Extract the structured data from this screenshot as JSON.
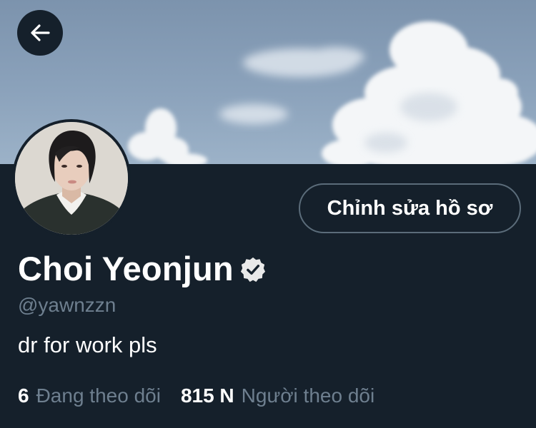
{
  "profile": {
    "display_name": "Choi Yeonjun",
    "handle": "@yawnzzn",
    "bio": "dr for work pls",
    "verified": true
  },
  "actions": {
    "back_icon": "arrow-left-icon",
    "edit_profile_label": "Chỉnh sửa hồ sơ"
  },
  "stats": {
    "following_count": "6",
    "following_label": "Đang theo dõi",
    "followers_count": "815 N",
    "followers_label": "Người theo dõi"
  },
  "colors": {
    "background": "#15202b",
    "text_primary": "#ffffff",
    "text_secondary": "#6e7f8f",
    "button_border": "#5b6c7a",
    "sky": "#8ba2bb"
  }
}
